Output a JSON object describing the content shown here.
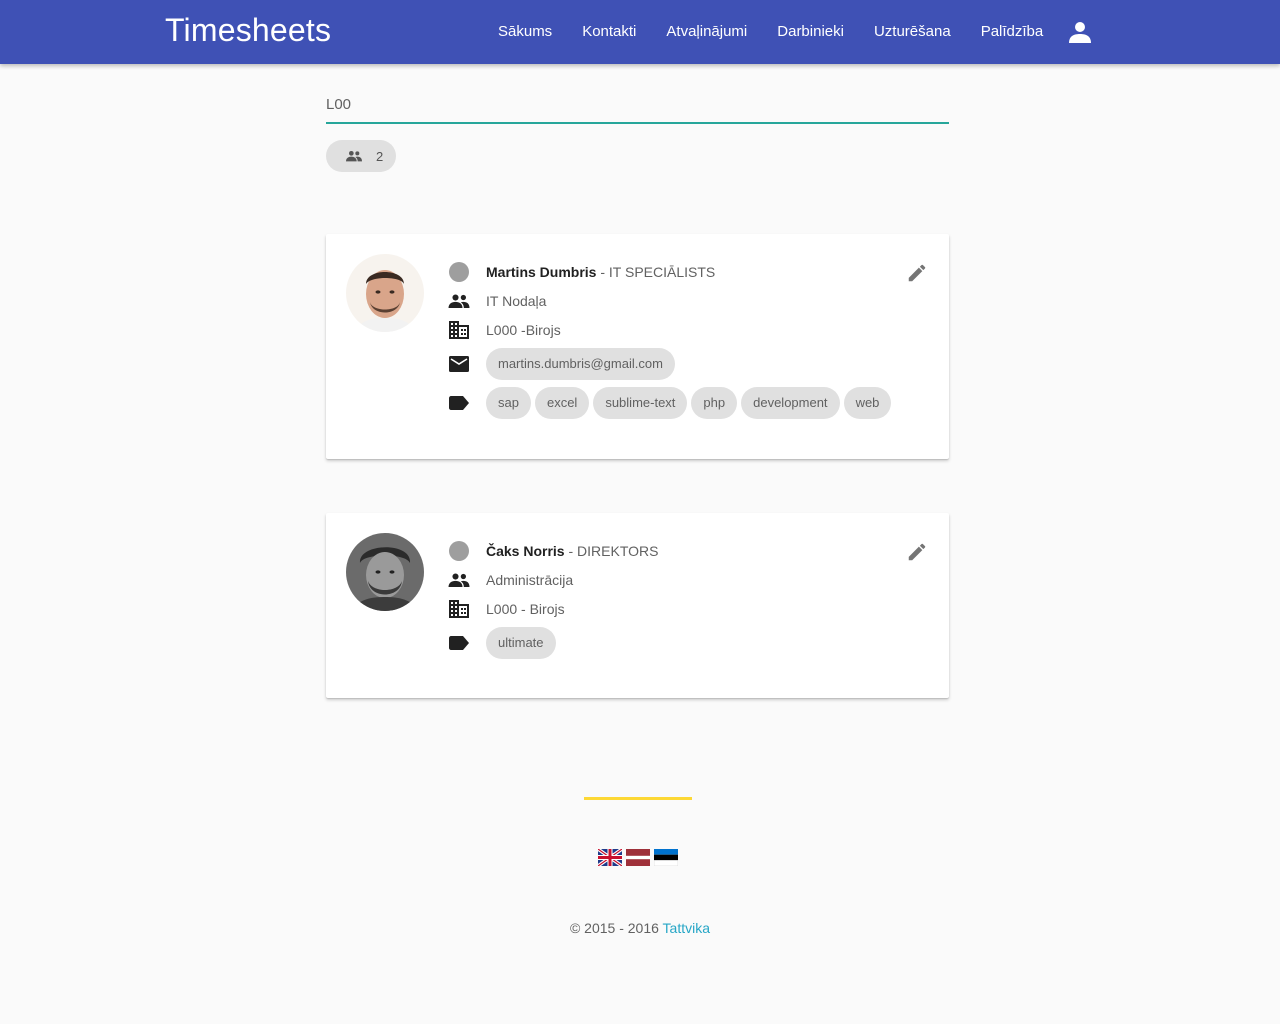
{
  "app": {
    "title": "Timesheets"
  },
  "nav": {
    "items": [
      {
        "label": "Sākums"
      },
      {
        "label": "Kontakti"
      },
      {
        "label": "Atvaļinājumi"
      },
      {
        "label": "Darbinieki"
      },
      {
        "label": "Uzturēšana"
      },
      {
        "label": "Palīdzība"
      }
    ],
    "user_icon": "account-icon"
  },
  "search": {
    "value": "L00"
  },
  "result_count": {
    "icon": "people-icon",
    "value": "2"
  },
  "contacts": [
    {
      "name": "Martins Dumbris",
      "role": "- IT SPECIĀLISTS",
      "department": "IT Nodaļa",
      "office": "L000 -Birojs",
      "email": "martins.dumbris@gmail.com",
      "tags": [
        "sap",
        "excel",
        "sublime-text",
        "php",
        "development",
        "web"
      ],
      "status_color": "#9e9e9e"
    },
    {
      "name": "Čaks Norris",
      "role": "- DIREKTORS",
      "department": "Administrācija",
      "office": "L000 - Birojs",
      "tags": [
        "ultimate"
      ],
      "status_color": "#9e9e9e"
    }
  ],
  "footer": {
    "copyright": "© 2015 - 2016",
    "company": "Tattvika",
    "accent_color": "#fdd835",
    "languages": [
      "uk-flag-icon",
      "latvia-flag-icon",
      "estonia-flag-icon"
    ]
  },
  "colors": {
    "primary": "#3f51b5",
    "accent": "#26a69a",
    "link": "#26a6c6"
  }
}
